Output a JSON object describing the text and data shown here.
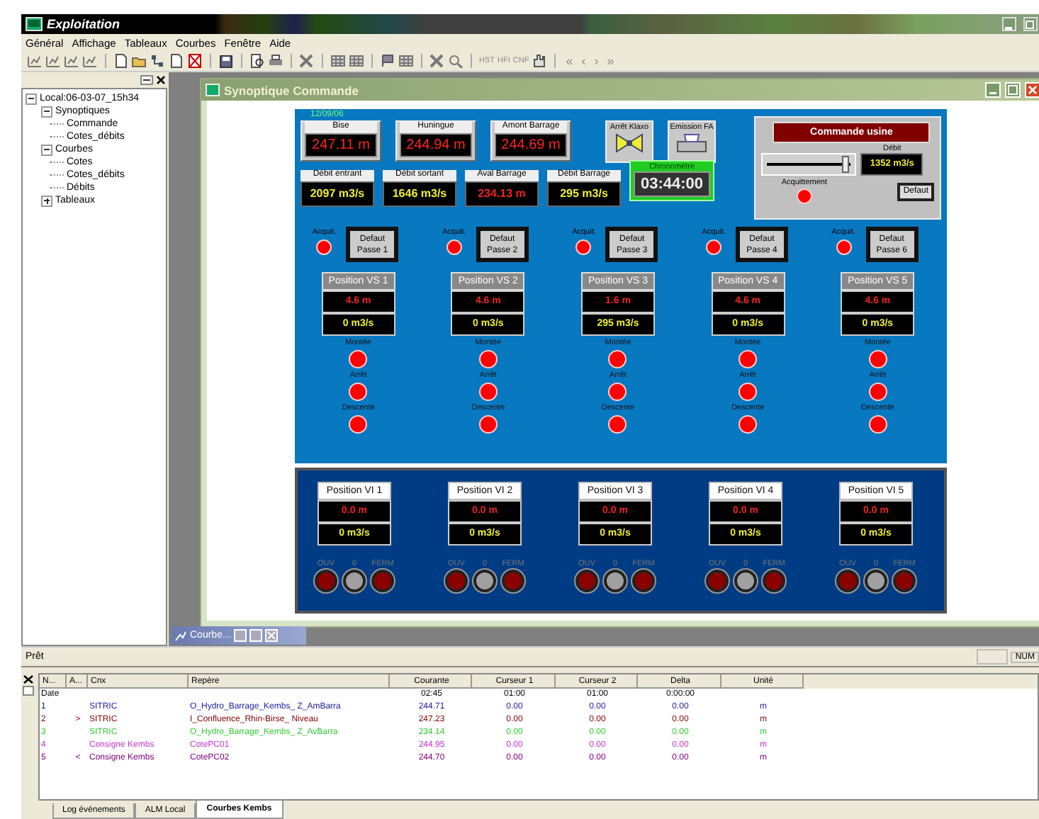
{
  "app": {
    "title": "Exploitation"
  },
  "menu": [
    "Général",
    "Affichage",
    "Tableaux",
    "Courbes",
    "Fenêtre",
    "Aide"
  ],
  "toolbar": {
    "text_buttons": [
      "HST",
      "HFI",
      "CNF"
    ],
    "nav_buttons": [
      "«",
      "‹",
      "›",
      "»"
    ]
  },
  "tree": [
    {
      "label": "Local:06-03-07_15h34",
      "expanded": true,
      "children": [
        {
          "label": "Synoptiques",
          "expanded": true,
          "children": [
            {
              "label": "Commande"
            },
            {
              "label": "Cotes_débits"
            }
          ]
        },
        {
          "label": "Courbes",
          "expanded": true,
          "children": [
            {
              "label": "Cotes"
            },
            {
              "label": "Cotes_débits"
            },
            {
              "label": "Débits"
            }
          ]
        },
        {
          "label": "Tableaux",
          "expanded": false
        }
      ]
    }
  ],
  "window": {
    "title": "Synoptique Commande"
  },
  "synoptic": {
    "date": "12/09/06",
    "levels": [
      {
        "label": "Bise",
        "value": "247.11 m"
      },
      {
        "label": "Huningue",
        "value": "244.94 m"
      },
      {
        "label": "Amont Barrage",
        "value": "244.69 m"
      }
    ],
    "buttons": [
      {
        "label": "Arrêt Klaxo",
        "kind": "horn"
      },
      {
        "label": "Emission FA",
        "kind": "printer"
      }
    ],
    "flows": [
      {
        "label": "Débit entrant",
        "value": "2097 m3/s",
        "kind": "flow"
      },
      {
        "label": "Débit sortant",
        "value": "1646 m3/s",
        "kind": "flow"
      },
      {
        "label": "Aval Barrage",
        "value": "234.13 m",
        "kind": "level"
      },
      {
        "label": "Débit Barrage",
        "value": "295 m3/s",
        "kind": "flow"
      }
    ],
    "chrono": {
      "label": "Chronomètre",
      "value": "03:44:00"
    },
    "command": {
      "title": "Commande usine",
      "slider": {
        "level": 0.93
      },
      "flow_label": "Débit",
      "flow_value": "1352 m3/s",
      "ack_label": "Acquittement",
      "default_button": "Defaut"
    },
    "gates": [
      {
        "ack_label": "Acquit.",
        "fault_button": "Defaut Passe 1",
        "title": "Position VS 1",
        "position": "4.6 m",
        "flow": "0 m3/s",
        "lights": [
          "Montée",
          "Arrêt",
          "Descente"
        ]
      },
      {
        "ack_label": "Acquit.",
        "fault_button": "Defaut Passe 2",
        "title": "Position VS 2",
        "position": "4.6 m",
        "flow": "0 m3/s",
        "lights": [
          "Montée",
          "Arrêt",
          "Descente"
        ]
      },
      {
        "ack_label": "Acquit.",
        "fault_button": "Defaut Passe 3",
        "title": "Position VS 3",
        "position": "1.6 m",
        "flow": "295 m3/s",
        "lights": [
          "Montée",
          "Arrêt",
          "Descente"
        ]
      },
      {
        "ack_label": "Acquit.",
        "fault_button": "Defaut Passe 4",
        "title": "Position VS 4",
        "position": "4.6 m",
        "flow": "0 m3/s",
        "lights": [
          "Montée",
          "Arrêt",
          "Descente"
        ]
      },
      {
        "ack_label": "Acquit.",
        "fault_button": "Defaut Passe 6",
        "title": "Position VS 5",
        "position": "4.6 m",
        "flow": "0 m3/s",
        "lights": [
          "Montée",
          "Arrêt",
          "Descente"
        ]
      }
    ],
    "valves": [
      {
        "title": "Position VI 1",
        "position": "0.0 m",
        "flow": "0 m3/s",
        "lights": [
          {
            "label": "OUV",
            "color": "#8b0000"
          },
          {
            "label": "0",
            "color": "#a0a0a0"
          },
          {
            "label": "FERM",
            "color": "#8b0000"
          }
        ]
      },
      {
        "title": "Position VI 2",
        "position": "0.0 m",
        "flow": "0 m3/s",
        "lights": [
          {
            "label": "OUV",
            "color": "#8b0000"
          },
          {
            "label": "0",
            "color": "#a0a0a0"
          },
          {
            "label": "FERM",
            "color": "#8b0000"
          }
        ]
      },
      {
        "title": "Position VI 3",
        "position": "0.0 m",
        "flow": "0 m3/s",
        "lights": [
          {
            "label": "OUV",
            "color": "#8b0000"
          },
          {
            "label": "0",
            "color": "#a0a0a0"
          },
          {
            "label": "FERM",
            "color": "#8b0000"
          }
        ]
      },
      {
        "title": "Position VI 4",
        "position": "0.0 m",
        "flow": "0 m3/s",
        "lights": [
          {
            "label": "OUV",
            "color": "#8b0000"
          },
          {
            "label": "0",
            "color": "#a0a0a0"
          },
          {
            "label": "FERM",
            "color": "#8b0000"
          }
        ]
      },
      {
        "title": "Position VI 5",
        "position": "0.0 m",
        "flow": "0 m3/s",
        "lights": [
          {
            "label": "OUV",
            "color": "#8b0000"
          },
          {
            "label": "0",
            "color": "#a0a0a0"
          },
          {
            "label": "FERM",
            "color": "#8b0000"
          }
        ]
      }
    ]
  },
  "minimized_window": {
    "title": "Courbe..."
  },
  "status_bar": {
    "text": "Prêt",
    "indicator": "NUM"
  },
  "table": {
    "columns": [
      "N...",
      "A...",
      "Cnx",
      "Repère",
      "Courante",
      "Curseur 1",
      "Curseur 2",
      "Delta",
      "Unité"
    ],
    "rows": [
      {
        "color": "#000000",
        "n": "Date",
        "courante": "02:45",
        "c1": "01:00",
        "c2": "01:00",
        "delta": "0:00:00"
      },
      {
        "color": "#1a1aa0",
        "n": "1",
        "cnx": "SITRIC",
        "repere": "O_Hydro_Barrage_Kembs_ Z_AmBarra",
        "courante": "244.71",
        "c1": "0.00",
        "c2": "0.00",
        "delta": "0.00",
        "unit": "m"
      },
      {
        "color": "#800000",
        "n": "2",
        "a": ">",
        "cnx": "SITRIC",
        "repere": "I_Confluence_Rhin-Birse_ Niveau",
        "courante": "247.23",
        "c1": "0.00",
        "c2": "0.00",
        "delta": "0.00",
        "unit": "m"
      },
      {
        "color": "#33cc33",
        "n": "3",
        "cnx": "SITRIC",
        "repere": "O_Hydro_Barrage_Kembs_ Z_AvBarra",
        "courante": "234.14",
        "c1": "0.00",
        "c2": "0.00",
        "delta": "0.00",
        "unit": "m"
      },
      {
        "color": "#cc33cc",
        "n": "4",
        "cnx": "Consigne Kembs",
        "repere": "CotePC01",
        "courante": "244.95",
        "c1": "0.00",
        "c2": "0.00",
        "delta": "0.00",
        "unit": "m"
      },
      {
        "color": "#800080",
        "n": "5",
        "a": "<",
        "cnx": "Consigne Kembs",
        "repere": "CotePC02",
        "courante": "244.70",
        "c1": "0.00",
        "c2": "0.00",
        "delta": "0.00",
        "unit": "m"
      }
    ]
  },
  "bottom_tabs": [
    {
      "label": "Log événements",
      "selected": false
    },
    {
      "label": "ALM Local",
      "selected": false
    },
    {
      "label": "Courbes Kembs",
      "selected": true
    }
  ]
}
